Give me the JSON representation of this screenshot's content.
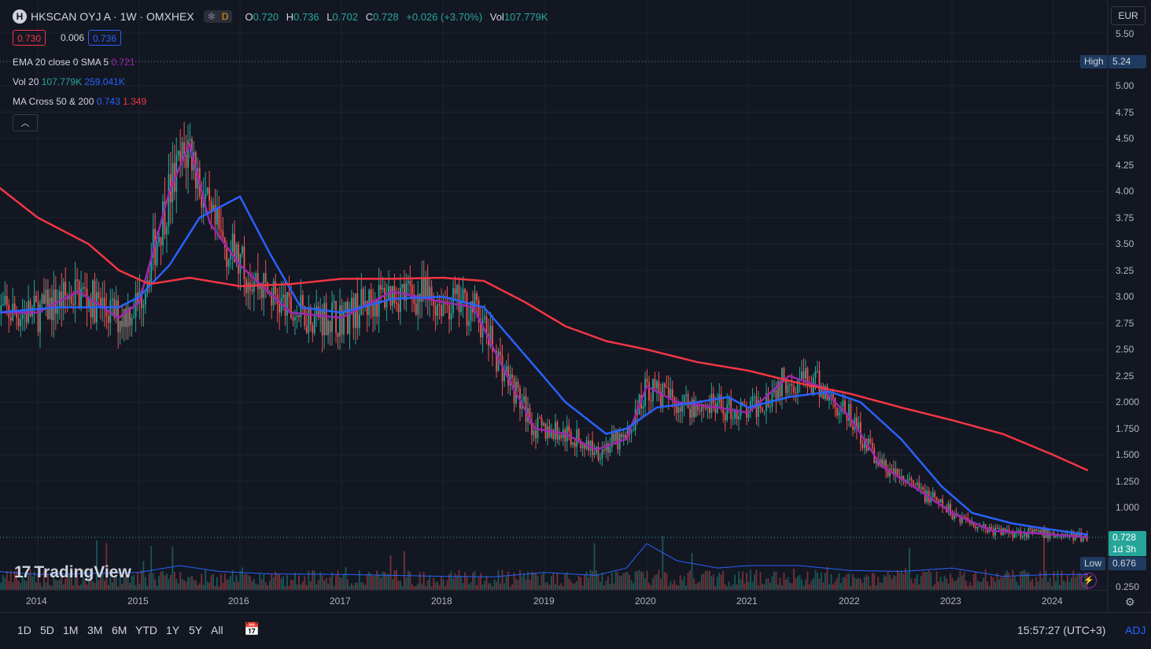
{
  "header": {
    "logo_letter": "H",
    "symbol": "HKSCAN OYJ A · 1W · OMXHEX",
    "flag_d": "D",
    "ohlc": {
      "o_label": "O",
      "o": "0.720",
      "h_label": "H",
      "h": "0.736",
      "l_label": "L",
      "l": "0.702",
      "c_label": "C",
      "c": "0.728",
      "change": "+0.026 (+3.70%)",
      "vol_label": "Vol",
      "vol": "107.779K"
    },
    "bid": "0.730",
    "spread": "0.006",
    "ask": "0.736"
  },
  "indicators": [
    {
      "name": "EMA 20 close 0 SMA 5",
      "values": [
        "0.721"
      ],
      "colors": [
        "#9c27b0"
      ]
    },
    {
      "name": "Vol 20",
      "values": [
        "107.779K",
        "259.041K"
      ],
      "colors": [
        "#26a69a",
        "#2962ff"
      ]
    },
    {
      "name": "MA Cross 50 & 200",
      "values": [
        "0.743",
        "1.349"
      ],
      "colors": [
        "#2962ff",
        "#f23645"
      ]
    }
  ],
  "currency": "EUR",
  "y_axis": [
    "5.50",
    "5.00",
    "4.75",
    "4.50",
    "4.25",
    "4.00",
    "3.75",
    "3.50",
    "3.25",
    "3.00",
    "2.75",
    "2.50",
    "2.25",
    "2.000",
    "1.750",
    "1.500",
    "1.250",
    "1.000",
    "0.250"
  ],
  "x_axis": [
    "2014",
    "2015",
    "2016",
    "2017",
    "2018",
    "2019",
    "2020",
    "2021",
    "2022",
    "2023",
    "2024"
  ],
  "tags": {
    "high_label": "High",
    "high": "5.24",
    "last": "0.728",
    "countdown": "1d 3h",
    "low_label": "Low",
    "low": "0.676"
  },
  "ranges": [
    "1D",
    "5D",
    "1M",
    "3M",
    "6M",
    "YTD",
    "1Y",
    "5Y",
    "All"
  ],
  "clock": "15:57:27 (UTC+3)",
  "adj": "ADJ",
  "brand": "TradingView",
  "colors": {
    "up": "#26a69a",
    "down": "#ef5350",
    "ema": "#9c27b0",
    "ma50": "#2962ff",
    "ma200": "#f23645"
  },
  "chart_data": {
    "type": "line",
    "series": [
      {
        "name": "EMA 20 close 0 SMA 5",
        "x": [
          2013.6,
          2014.0,
          2014.4,
          2014.8,
          2015.0,
          2015.3,
          2015.5,
          2015.7,
          2016.0,
          2016.5,
          2017.0,
          2017.5,
          2018.0,
          2018.3,
          2018.6,
          2018.9,
          2019.2,
          2019.5,
          2019.8,
          2020.0,
          2020.3,
          2020.7,
          2021.0,
          2021.4,
          2021.7,
          2022.0,
          2022.3,
          2022.7,
          2023.0,
          2023.4,
          2023.8,
          2024.2,
          2024.35
        ],
        "y": [
          2.85,
          2.85,
          3.05,
          2.8,
          2.95,
          4.0,
          4.45,
          3.7,
          3.3,
          2.85,
          2.8,
          3.05,
          2.95,
          2.9,
          2.3,
          1.75,
          1.7,
          1.55,
          1.65,
          2.15,
          2.0,
          1.95,
          1.9,
          2.25,
          2.15,
          1.85,
          1.4,
          1.15,
          0.95,
          0.78,
          0.76,
          0.73,
          0.721
        ]
      },
      {
        "name": "MA Cross 50",
        "x": [
          2013.6,
          2014.2,
          2014.8,
          2015.0,
          2015.3,
          2015.6,
          2016.0,
          2016.3,
          2016.6,
          2017.0,
          2017.5,
          2018.0,
          2018.4,
          2018.8,
          2019.2,
          2019.6,
          2019.8,
          2020.1,
          2020.5,
          2020.8,
          2021.0,
          2021.4,
          2021.8,
          2022.1,
          2022.5,
          2022.9,
          2023.2,
          2023.6,
          2024.0,
          2024.35
        ],
        "y": [
          2.85,
          2.9,
          2.9,
          3.0,
          3.3,
          3.75,
          3.95,
          3.4,
          2.9,
          2.85,
          2.98,
          3.0,
          2.9,
          2.45,
          2.0,
          1.7,
          1.75,
          1.95,
          2.0,
          2.05,
          1.95,
          2.05,
          2.1,
          2.0,
          1.65,
          1.2,
          0.95,
          0.85,
          0.79,
          0.743
        ]
      },
      {
        "name": "MA Cross 200",
        "x": [
          2013.6,
          2014.0,
          2014.5,
          2014.8,
          2015.1,
          2015.5,
          2016.0,
          2016.5,
          2017.0,
          2017.5,
          2018.0,
          2018.4,
          2018.8,
          2019.2,
          2019.6,
          2020.0,
          2020.5,
          2021.0,
          2021.5,
          2022.0,
          2022.5,
          2023.0,
          2023.5,
          2024.0,
          2024.35
        ],
        "y": [
          4.05,
          3.75,
          3.5,
          3.25,
          3.12,
          3.18,
          3.1,
          3.12,
          3.17,
          3.17,
          3.18,
          3.15,
          2.95,
          2.72,
          2.58,
          2.5,
          2.38,
          2.3,
          2.18,
          2.08,
          1.95,
          1.83,
          1.7,
          1.5,
          1.349
        ]
      },
      {
        "name": "Vol 20",
        "x": [
          2013.6,
          2014.0,
          2014.5,
          2015.0,
          2015.4,
          2015.8,
          2016.3,
          2017.0,
          2017.5,
          2018.0,
          2018.5,
          2019.0,
          2019.5,
          2019.8,
          2020.0,
          2020.3,
          2020.7,
          2021.0,
          2021.5,
          2022.0,
          2022.5,
          2023.0,
          2023.5,
          2024.0,
          2024.35
        ],
        "y": [
          0.38,
          0.32,
          0.34,
          0.36,
          0.5,
          0.38,
          0.33,
          0.32,
          0.3,
          0.28,
          0.27,
          0.36,
          0.3,
          0.45,
          0.95,
          0.6,
          0.45,
          0.5,
          0.5,
          0.4,
          0.38,
          0.45,
          0.28,
          0.32,
          0.32
        ]
      }
    ],
    "ylim": [
      0.25,
      5.5
    ],
    "xlim": [
      2013.6,
      2024.7
    ]
  }
}
